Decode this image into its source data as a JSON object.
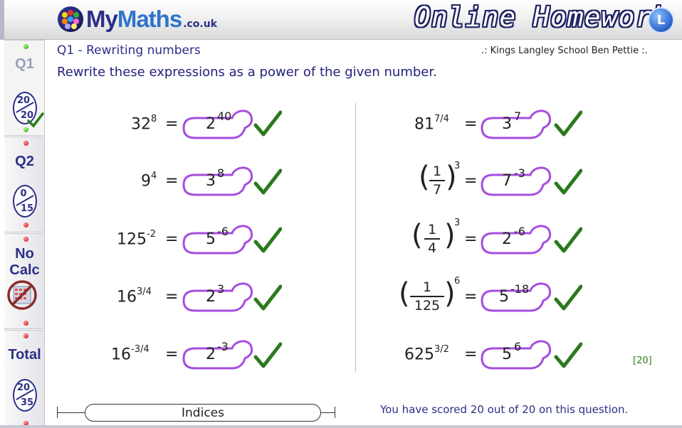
{
  "header": {
    "logo_my": "My",
    "logo_maths": "Maths",
    "logo_tld": ".co.uk",
    "title": "Online Homework",
    "corner_button_glyph": "L"
  },
  "sidebar": {
    "tabs": [
      {
        "label": "Q1",
        "score_num": "20",
        "score_den": "20",
        "state": "active"
      },
      {
        "label": "Q2",
        "score_num": "0",
        "score_den": "15",
        "state": "normal"
      },
      {
        "label_line1": "No",
        "label_line2": "Calc",
        "icon": "no-calculator-icon"
      },
      {
        "label": "Total",
        "score_num": "20",
        "score_den": "35"
      }
    ]
  },
  "question": {
    "title": "Q1 - Rewriting numbers",
    "school": ".: Kings Langley School  Ben Pettie :.",
    "instruction": "Rewrite these expressions as a power of the given number.",
    "marks": "[20]"
  },
  "left_items": [
    {
      "base": "32",
      "exp": "8",
      "ans_base": "2",
      "ans_exp": "40"
    },
    {
      "base": "9",
      "exp": "4",
      "ans_base": "3",
      "ans_exp": "8"
    },
    {
      "base": "125",
      "exp": "-2",
      "ans_base": "5",
      "ans_exp": "-6"
    },
    {
      "base": "16",
      "exp": "3/4",
      "ans_base": "2",
      "ans_exp": "3"
    },
    {
      "base": "16",
      "exp": "-3/4",
      "ans_base": "2",
      "ans_exp": "-3"
    }
  ],
  "right_items": [
    {
      "base": "81",
      "exp": "7/4",
      "ans_base": "3",
      "ans_exp": "7"
    },
    {
      "frac_num": "1",
      "frac_den": "7",
      "exp": "3",
      "ans_base": "7",
      "ans_exp": "-3"
    },
    {
      "frac_num": "1",
      "frac_den": "4",
      "exp": "3",
      "ans_base": "2",
      "ans_exp": "-6"
    },
    {
      "frac_num": "1",
      "frac_den": "125",
      "exp": "6",
      "ans_base": "5",
      "ans_exp": "-18"
    },
    {
      "base": "625",
      "exp": "3/2",
      "ans_base": "5",
      "ans_exp": "6"
    }
  ],
  "equals": "=",
  "footer": {
    "topic": "Indices",
    "status": "You have scored 20 out of 20 on this question."
  },
  "colors": {
    "navy": "#2b2f87",
    "bubble": "#a64de0",
    "tick": "#2a7a1d",
    "marks": "#2e7d1a"
  }
}
